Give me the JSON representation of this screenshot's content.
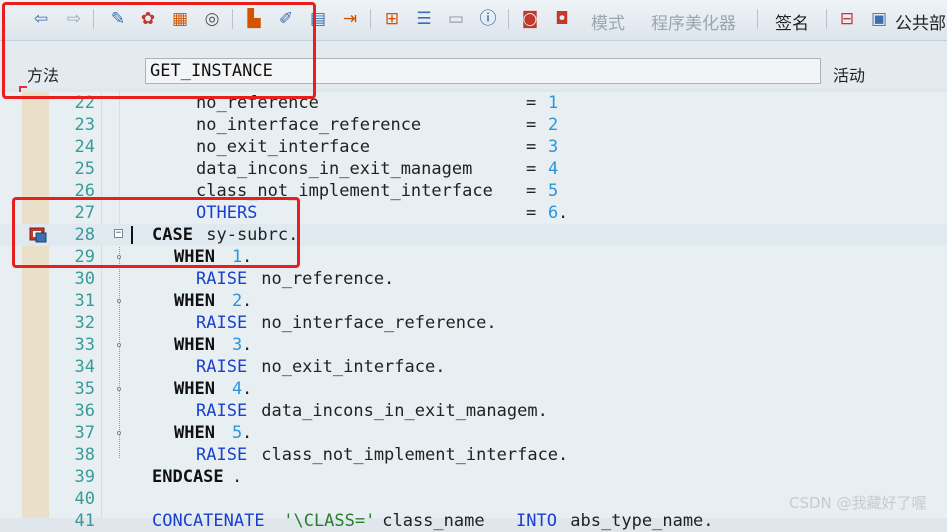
{
  "toolbar": {
    "mode_label": "模式",
    "pretty_printer_label": "程序美化器",
    "signature_label": "签名",
    "public_label": "公共部",
    "icons": [
      "back-arrow-icon",
      "forward-arrow-icon",
      "toggle-edit-icon",
      "check-icon",
      "where-used-icon",
      "activate-icon",
      "object-list-icon",
      "display-object-icon",
      "stack-icon",
      "navigate-icon",
      "hierarchy-icon",
      "outline-icon",
      "layout-icon",
      "info-icon",
      "breakpoint-session-icon",
      "breakpoint-external-icon",
      "class-structure-icon",
      "public-section-icon"
    ]
  },
  "method": {
    "label": "方法",
    "name": "GET_INSTANCE",
    "status": "活动"
  },
  "code_lines": [
    {
      "num": "22"
    },
    {
      "num": "23"
    },
    {
      "num": "24"
    },
    {
      "num": "25"
    },
    {
      "num": "26"
    },
    {
      "num": "27"
    },
    {
      "num": "28"
    },
    {
      "num": "29"
    },
    {
      "num": "30"
    },
    {
      "num": "31"
    },
    {
      "num": "32"
    },
    {
      "num": "33"
    },
    {
      "num": "34"
    },
    {
      "num": "35"
    },
    {
      "num": "36"
    },
    {
      "num": "37"
    },
    {
      "num": "38"
    },
    {
      "num": "39"
    },
    {
      "num": "40"
    },
    {
      "num": "41"
    }
  ],
  "code": {
    "l22_name": "no_reference",
    "l22_eq": "= ",
    "l22_val": "1",
    "l23_name": "no_interface_reference",
    "l23_eq": "= ",
    "l23_val": "2",
    "l24_name": "no_exit_interface",
    "l24_eq": "= ",
    "l24_val": "3",
    "l25_name": "data_incons_in_exit_managem",
    "l25_eq": "= ",
    "l25_val": "4",
    "l26_name": "class_not_implement_interface",
    "l26_eq": "= ",
    "l26_val": "5",
    "l27_name": "OTHERS",
    "l27_eq": "= ",
    "l27_val": "6",
    "l27_end": ".",
    "l28_kw": "CASE",
    "l28_rest": " sy-subrc.",
    "l29_kw": "WHEN",
    "l29_val": "1",
    "l29_end": ".",
    "l30_kw": "RAISE",
    "l30_rest": " no_reference.",
    "l31_kw": "WHEN",
    "l31_val": "2",
    "l31_end": ".",
    "l32_kw": "RAISE",
    "l32_rest": " no_interface_reference.",
    "l33_kw": "WHEN",
    "l33_val": "3",
    "l33_end": ".",
    "l34_kw": "RAISE",
    "l34_rest": " no_exit_interface.",
    "l35_kw": "WHEN",
    "l35_val": "4",
    "l35_end": ".",
    "l36_kw": "RAISE",
    "l36_rest": " data_incons_in_exit_managem.",
    "l37_kw": "WHEN",
    "l37_val": "5",
    "l37_end": ".",
    "l38_kw": "RAISE",
    "l38_rest": " class_not_implement_interface.",
    "l39_kw": "ENDCASE",
    "l39_end": ".",
    "l41_kw": "CONCATENATE",
    "l41_str": " '\\CLASS='",
    "l41_rest": " class_name ",
    "l41_kw2": "INTO",
    "l41_rest2": " abs_type_name."
  },
  "watermark": "CSDN @我藏好了喔",
  "colors": {
    "annotation": "#e8201d",
    "keyword_blue": "#1a3fd0",
    "number_blue": "#2b95d8",
    "line_number": "#3a9a9a"
  }
}
